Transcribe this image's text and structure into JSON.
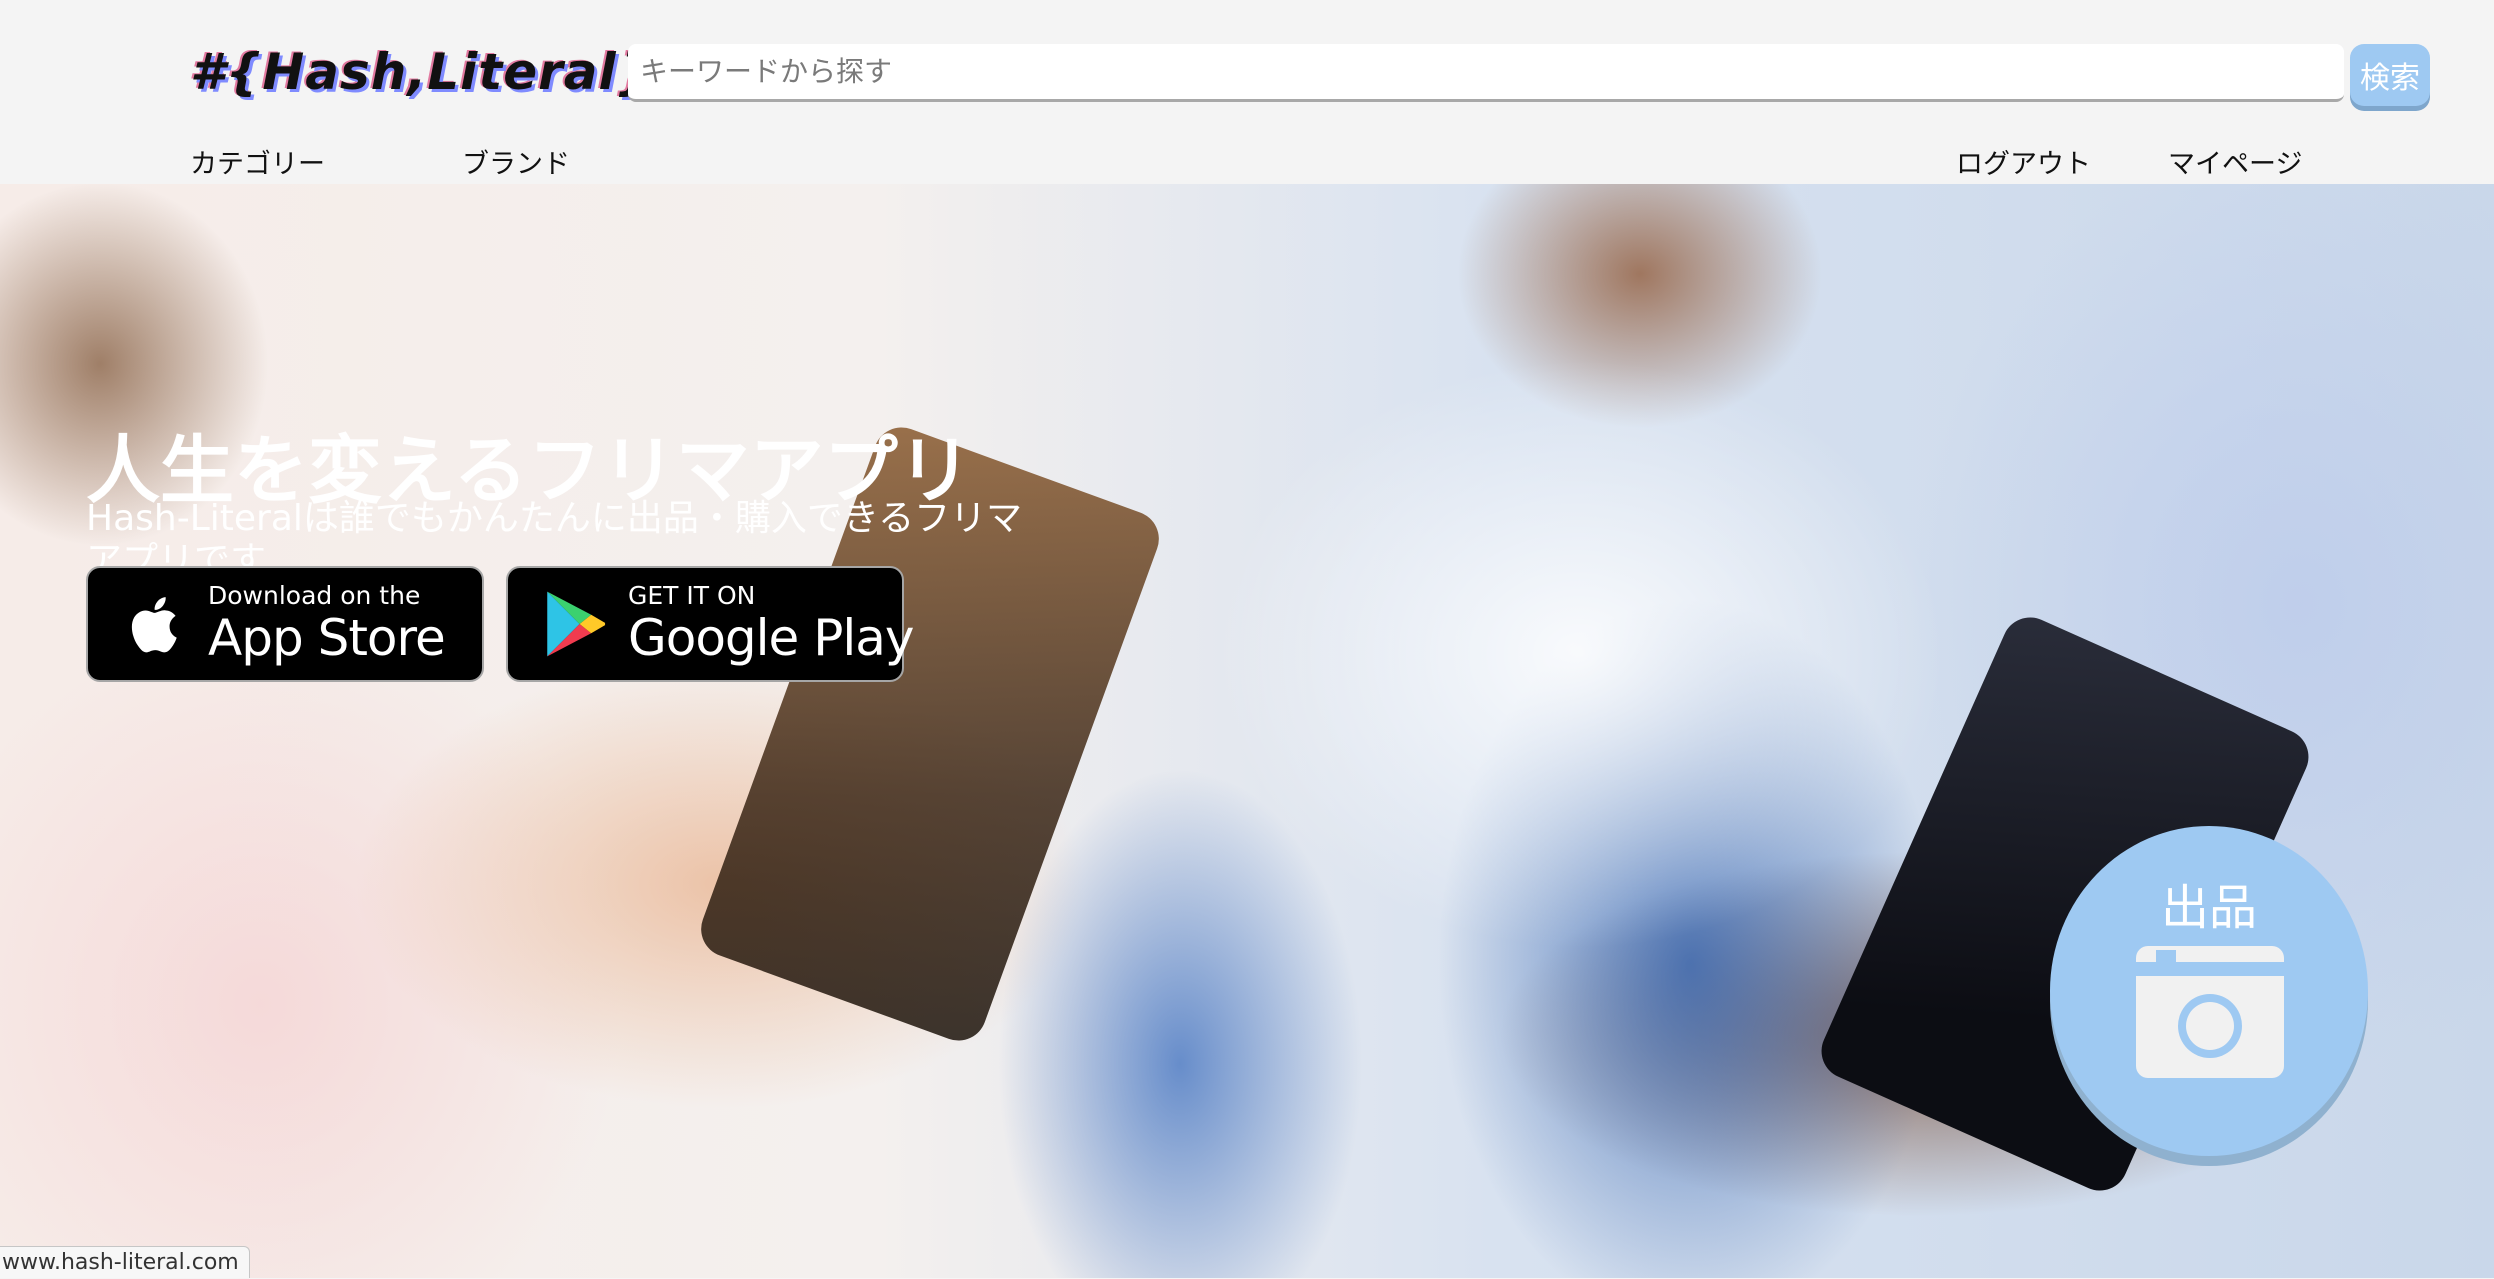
{
  "header": {
    "logo_text": "#{Hash,Literal}",
    "search": {
      "placeholder": "キーワードから探す",
      "value": "",
      "button_label": "検索"
    },
    "nav_left": [
      {
        "label": "カテゴリー"
      },
      {
        "label": "ブランド"
      }
    ],
    "nav_right": [
      {
        "label": "ログアウト"
      },
      {
        "label": "マイページ"
      }
    ]
  },
  "hero": {
    "title": "人生を変えるフリマアプリ",
    "subtitle": "Hash-Literalは誰でもかんたんに出品・購入できるフリマアプリです",
    "app_store": {
      "small_text": "Download on the",
      "large_text": "App Store",
      "icon": "apple-icon"
    },
    "google_play": {
      "small_text": "GET IT ON",
      "large_text": "Google Play",
      "icon": "google-play-icon"
    }
  },
  "sell_button": {
    "label": "出品",
    "icon": "camera-icon"
  },
  "status_bar": {
    "url": "www.hash-literal.com"
  },
  "colors": {
    "accent": "#9ec9f2",
    "header_bg": "#f4f4f4",
    "text": "#111111",
    "badge_bg": "#000000"
  }
}
